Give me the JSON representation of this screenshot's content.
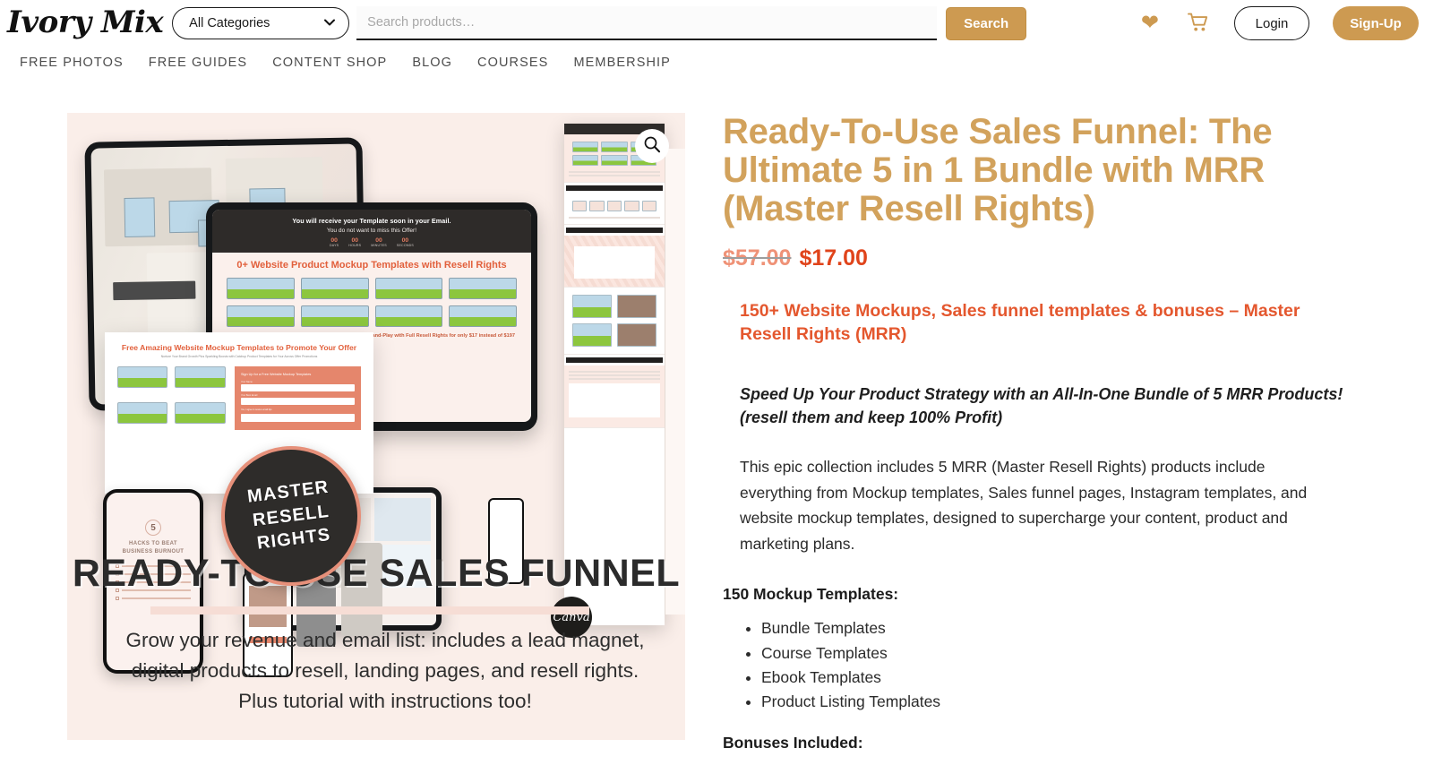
{
  "header": {
    "logo": "Ivory Mix",
    "category_select": {
      "selected": "All Categories",
      "options": [
        "All Categories"
      ]
    },
    "search": {
      "value": "",
      "placeholder": "Search products…"
    },
    "search_button": "Search",
    "wishlist_icon": "heart-icon",
    "cart_icon": "cart-icon",
    "login_button": "Login",
    "signup_button": "Sign-Up",
    "accent_color": "#cd9a51"
  },
  "nav": {
    "items": [
      {
        "label": "FREE PHOTOS"
      },
      {
        "label": "FREE GUIDES"
      },
      {
        "label": "CONTENT SHOP"
      },
      {
        "label": "BLOG"
      },
      {
        "label": "COURSES"
      },
      {
        "label": "MEMBERSHIP"
      }
    ]
  },
  "gallery": {
    "zoom_icon": "magnifier-icon",
    "badge_lines": [
      "MASTER",
      "RESELL",
      "RIGHTS"
    ],
    "banner_title": "READY-TO-USE SALES FUNNEL",
    "banner_body": "Grow your revenue and email list: includes a lead magnet, digital products to resell, landing pages, and resell rights. Plus tutorial with instructions too!",
    "mock_countdown": {
      "headline": "You will receive your Template soon in your Email.",
      "subline": "You do not want to miss this Offer!",
      "units": [
        {
          "value": "00",
          "label": "DAYS"
        },
        {
          "value": "00",
          "label": "HOURS"
        },
        {
          "value": "00",
          "label": "MINUTES"
        },
        {
          "value": "00",
          "label": "SECONDS"
        }
      ]
    },
    "mock_funnel_headline": "0+ Website Product Mockup Templates with Resell Rights",
    "mock_funnel_sub": "Business Promotion! Elevate Your Brand with Exclusive Plug-and-Play with Full Resell Rights for only $17 instead of $197 with 100% Profit.",
    "mock_optin": {
      "title": "Free Amazing Website Mockup Templates to Promote Your Offer",
      "sub": "Nurture Your Brand Growth Plus Sparkling Boosts with Catchup Product Templates for Your Across Offer Promotions",
      "form_title": "Sign Up for a Free Website Mockup Templates",
      "field1_label": "Your Name",
      "field2_label": "Your Best Email",
      "checkbox_label": "Yes, I agree to receive email tips",
      "submit_label": "Confirm, Subscribe Now"
    },
    "mock_phone": {
      "number": "5",
      "heading": "HACKS TO BEAT BUSINESS BURNOUT"
    },
    "canva_label": "Canva",
    "bg_color": "#faeee9"
  },
  "product": {
    "title": "Ready-To-Use Sales Funnel: The Ultimate 5 in 1 Bundle with MRR (Master Resell Rights)",
    "price_old": "$57.00",
    "price_new": "$17.00",
    "heading": "150+ Website Mockups, Sales funnel templates & bonuses – Master Resell Rights (MRR)",
    "tagline": "Speed Up Your Product Strategy with an All-In-One Bundle of 5 MRR Products! (resell them and keep 100% Profit)",
    "paragraph": "This epic collection includes 5 MRR (Master Resell Rights) products include everything from Mockup templates, Sales funnel pages, Instagram templates, and website mockup templates, designed to supercharge your content, product and marketing plans.",
    "mockups_heading": "150 Mockup Templates:",
    "mockups_list": [
      "Bundle Templates",
      "Course Templates",
      "Ebook Templates",
      "Product Listing Templates"
    ],
    "bonuses_heading": "Bonuses Included:",
    "title_color": "#d2a25c",
    "heading_color": "#e4572e",
    "price_color": "#e0441b"
  }
}
